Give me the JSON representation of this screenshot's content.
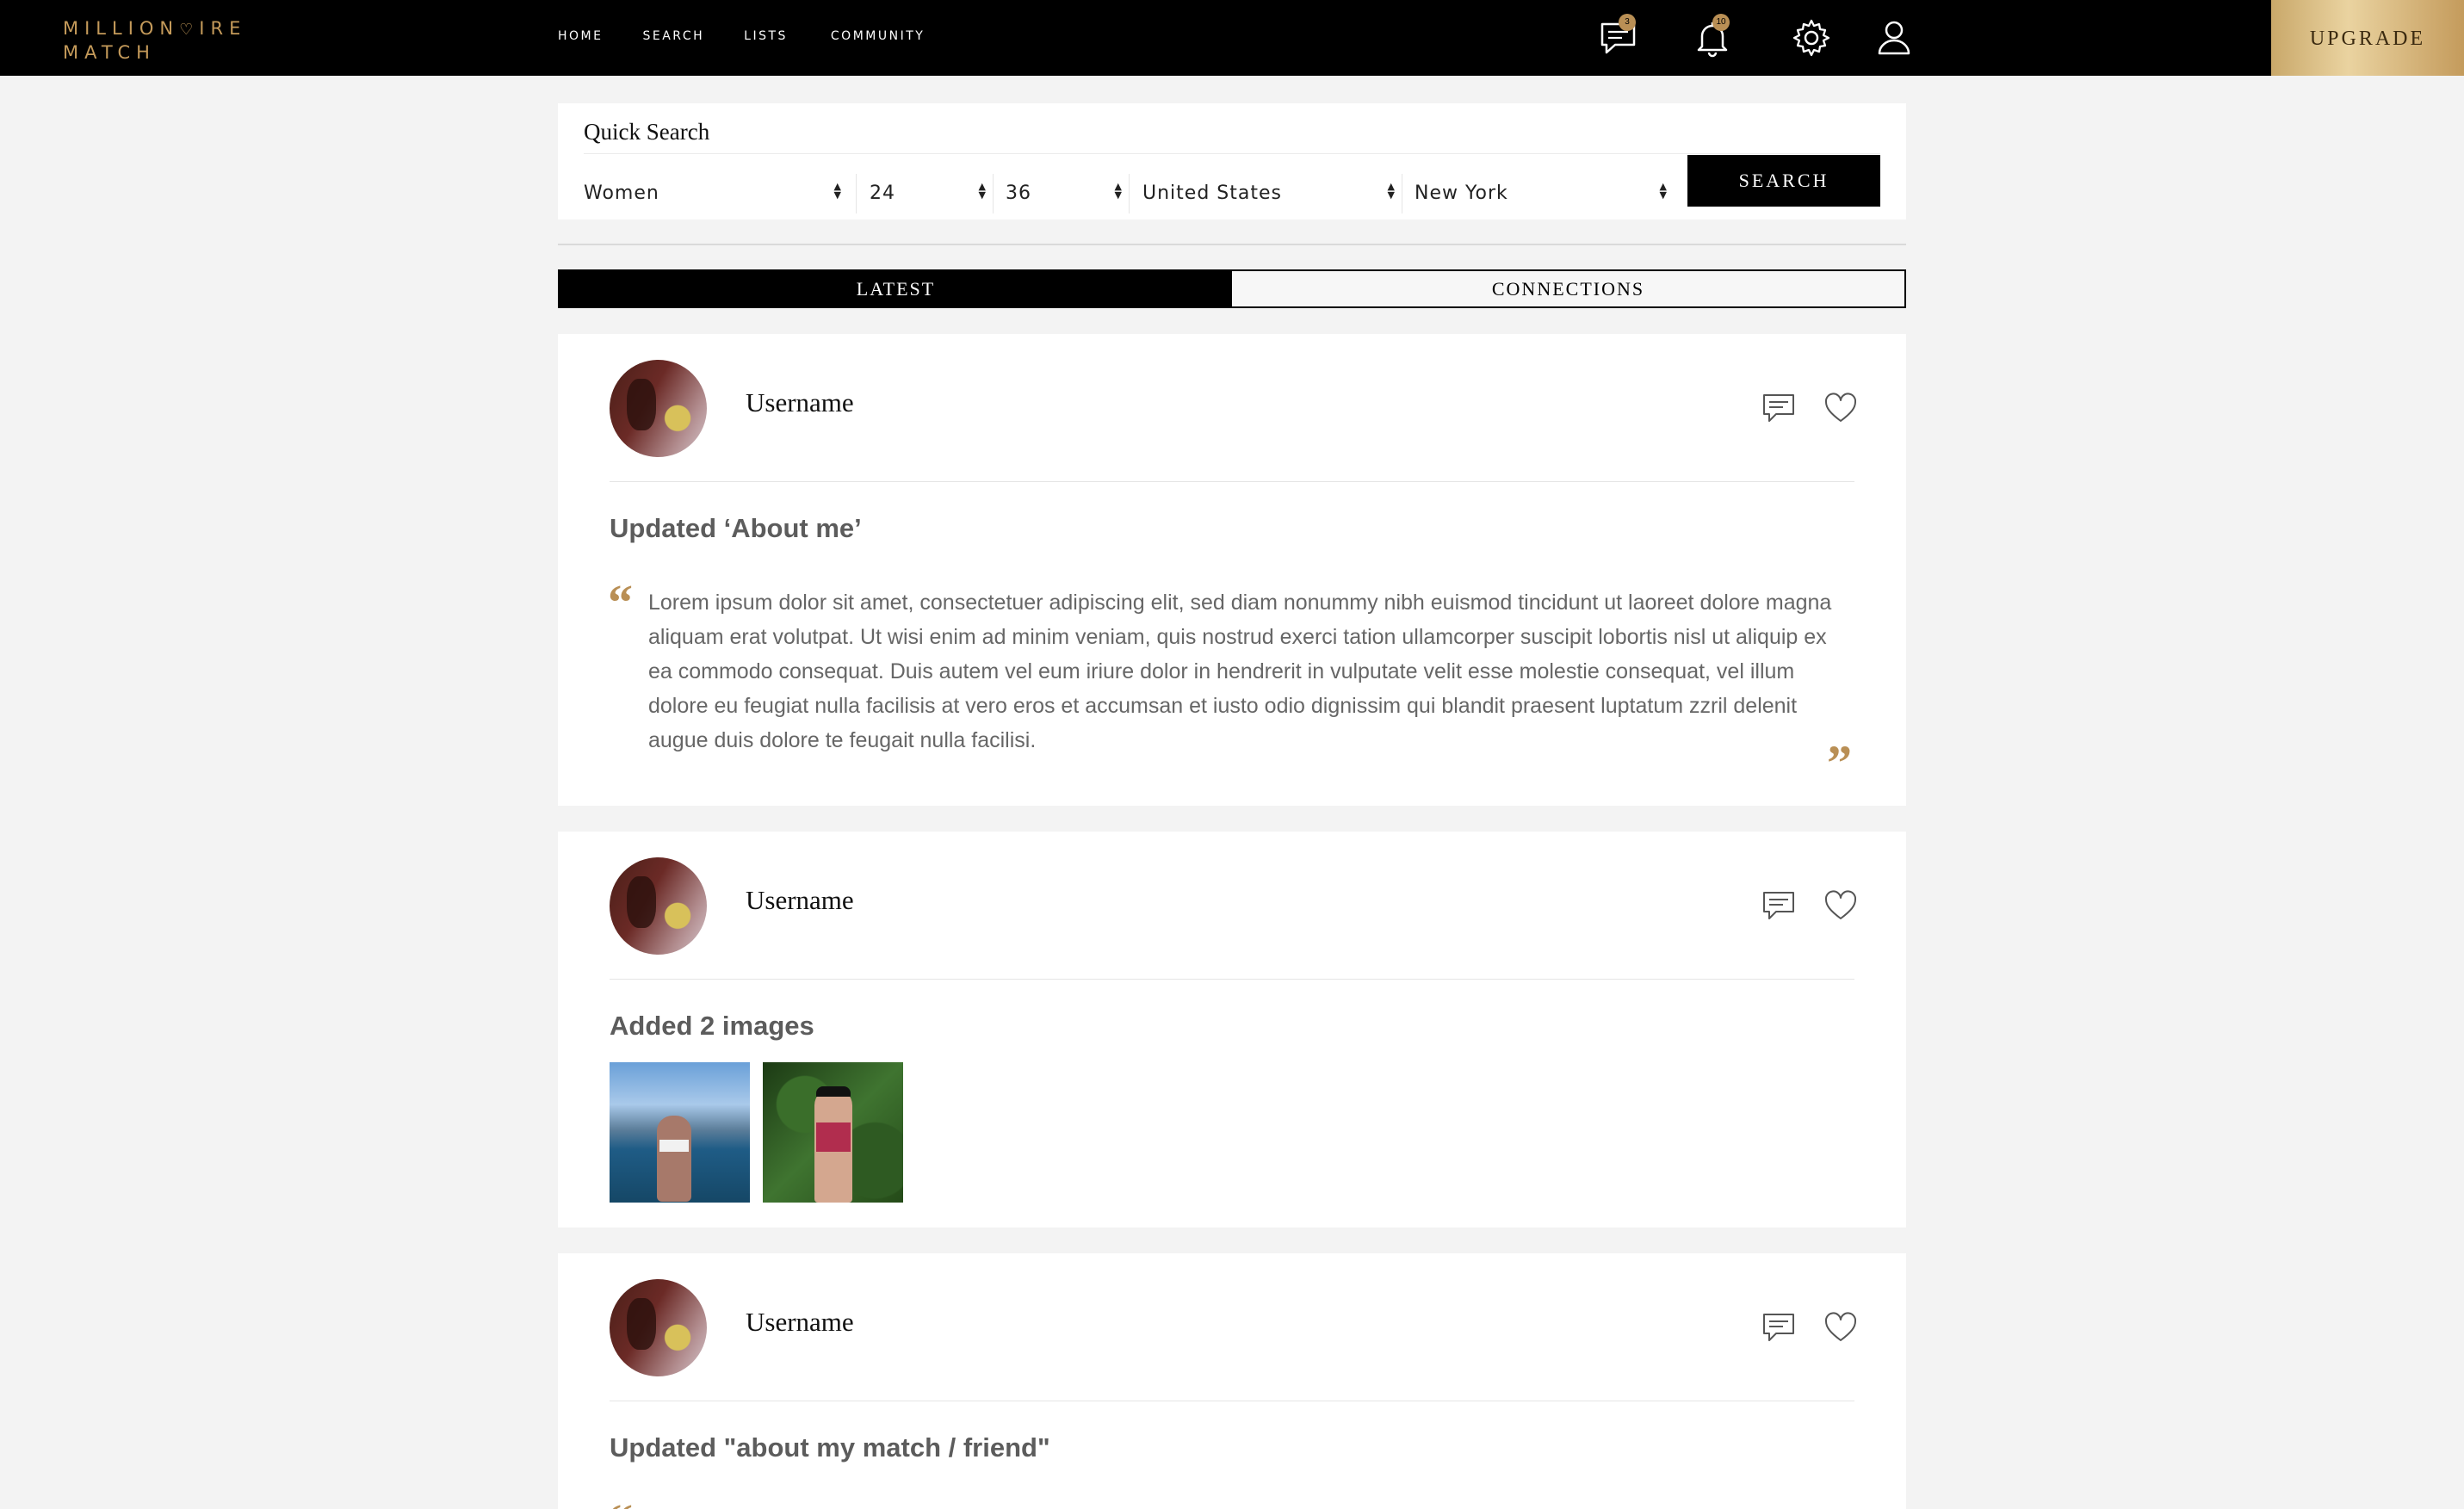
{
  "app": {
    "logo_line1": "MILLION",
    "logo_heart": "♡",
    "logo_line1_end": "IRE",
    "logo_line2": "MATCH"
  },
  "nav": {
    "items": [
      {
        "label": "HOME"
      },
      {
        "label": "SEARCH"
      },
      {
        "label": "LISTS"
      },
      {
        "label": "COMMUNITY"
      }
    ]
  },
  "header_icons": {
    "messages_badge": "3",
    "notifications_badge": "10",
    "icons": [
      "messages-icon",
      "bell-icon",
      "gear-icon",
      "user-icon"
    ]
  },
  "upgrade_label": "UPGRADE",
  "quick_search": {
    "title": "Quick Search",
    "gender": "Women",
    "age_min": "24",
    "age_max": "36",
    "country": "United States",
    "city": "New York",
    "search_label": "SEARCH"
  },
  "tabs": [
    {
      "label": "LATEST",
      "active": true
    },
    {
      "label": "CONNECTIONS",
      "active": false
    }
  ],
  "feed": [
    {
      "username": "Username",
      "heading": "Updated ‘About me’",
      "quote": "Lorem ipsum dolor sit amet, consectetuer adipiscing elit, sed diam nonummy nibh euismod tincidunt ut laoreet dolore magna aliquam erat volutpat. Ut wisi enim ad minim veniam, quis nostrud exerci tation ullamcorper suscipit lobortis nisl ut aliquip ex ea commodo consequat. Duis autem vel eum iriure dolor in hendrerit in vulputate velit esse molestie consequat, vel illum dolore eu feugiat nulla facilisis at vero eros et accumsan et iusto odio dignissim qui blandit praesent luptatum zzril delenit augue duis dolore te feugait nulla facilisi."
    },
    {
      "username": "Username",
      "heading": "Added 2 images"
    },
    {
      "username": "Username",
      "heading": "Updated \"about my match / friend\""
    }
  ],
  "quote_marks": {
    "open": "“",
    "close": "”"
  },
  "colors": {
    "accent": "#b98f55",
    "topbar": "#000000",
    "background": "#f3f3f3"
  }
}
